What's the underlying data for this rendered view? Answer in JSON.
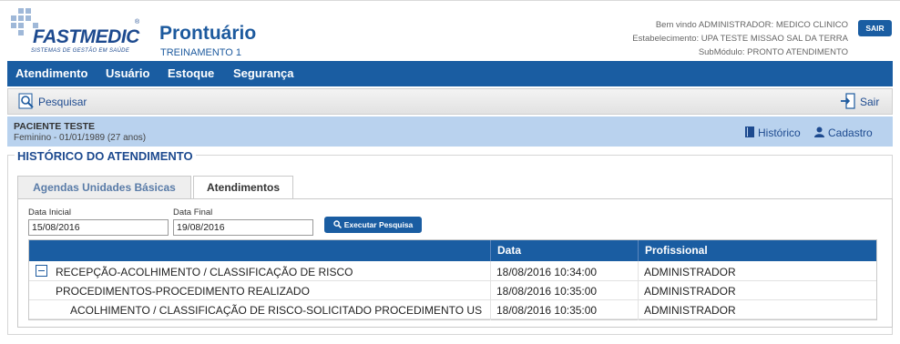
{
  "header": {
    "logo_text": "FASTMEDIC",
    "logo_sub": "SISTEMAS DE GESTÃO EM SAÚDE",
    "logo_reg": "®",
    "title": "Prontuário",
    "subtitle": "TREINAMENTO 1",
    "welcome": "Bem vindo ADMINISTRADOR: MEDICO CLINICO",
    "establishment": "Estabelecimento: UPA TESTE MISSAO SAL DA TERRA",
    "submodule": "SubMódulo: PRONTO ATENDIMENTO",
    "logout_label": "SAIR"
  },
  "menu": {
    "items": [
      "Atendimento",
      "Usuário",
      "Estoque",
      "Segurança"
    ]
  },
  "toolbar": {
    "search_label": "Pesquisar",
    "exit_label": "Sair"
  },
  "patient": {
    "name": "PACIENTE TESTE",
    "info": "Feminino - 01/01/1989 (27 anos)",
    "history_label": "Histórico",
    "register_label": "Cadastro"
  },
  "section": {
    "title": "HISTÓRICO DO ATENDIMENTO",
    "tabs": [
      {
        "label": "Agendas Unidades Básicas",
        "active": false
      },
      {
        "label": "Atendimentos",
        "active": true
      }
    ]
  },
  "filters": {
    "start_label": "Data Inicial",
    "start_value": "15/08/2016",
    "end_label": "Data Final",
    "end_value": "19/08/2016",
    "search_button": "Executar Pesquisa"
  },
  "grid": {
    "columns": [
      "",
      "Data",
      "Profissional"
    ],
    "rows": [
      {
        "description": "RECEPÇÃO-ACOLHIMENTO / CLASSIFICAÇÃO DE RISCO",
        "date": "18/08/2016 10:34:00",
        "professional": "ADMINISTRADOR",
        "level": 0,
        "expanded": true
      },
      {
        "description": "PROCEDIMENTOS-PROCEDIMENTO REALIZADO",
        "date": "18/08/2016 10:35:00",
        "professional": "ADMINISTRADOR",
        "level": 1
      },
      {
        "description": "ACOLHIMENTO / CLASSIFICAÇÃO DE RISCO-SOLICITADO PROCEDIMENTO US",
        "date": "18/08/2016 10:35:00",
        "professional": "ADMINISTRADOR",
        "level": 2
      }
    ]
  },
  "colors": {
    "brand_blue": "#1a5da2",
    "patient_bar": "#b9d2ee",
    "title_blue": "#1d5a9e"
  }
}
